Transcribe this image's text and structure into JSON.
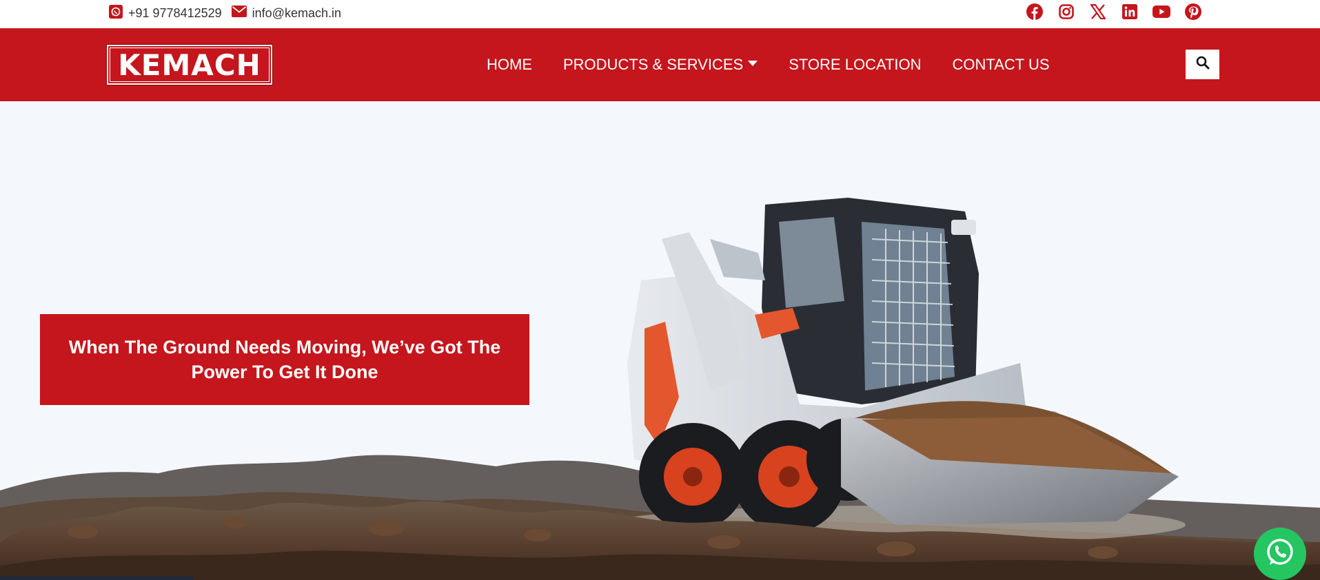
{
  "topbar": {
    "phone": "+91 9778412529",
    "phone_icon": "whatsapp-square-icon",
    "email": "info@kemach.in",
    "email_icon": "envelope-icon",
    "socials": [
      "facebook-icon",
      "instagram-icon",
      "x-twitter-icon",
      "linkedin-icon",
      "youtube-icon",
      "pinterest-icon"
    ]
  },
  "brand": {
    "logo_text": "KEMACH"
  },
  "nav": {
    "items": [
      "HOME",
      "PRODUCTS & SERVICES",
      "STORE LOCATION",
      "CONTACT US"
    ],
    "search_icon": "search-icon"
  },
  "hero": {
    "tagline": "When The Ground Needs Moving, We’ve Got The Power To Get It Done",
    "image": "skid-steer-loader-on-dirt"
  },
  "floating": {
    "whatsapp_icon": "whatsapp-icon"
  },
  "colors": {
    "brand_red": "#c4161c",
    "whatsapp_green": "#25c562",
    "white": "#ffffff"
  }
}
